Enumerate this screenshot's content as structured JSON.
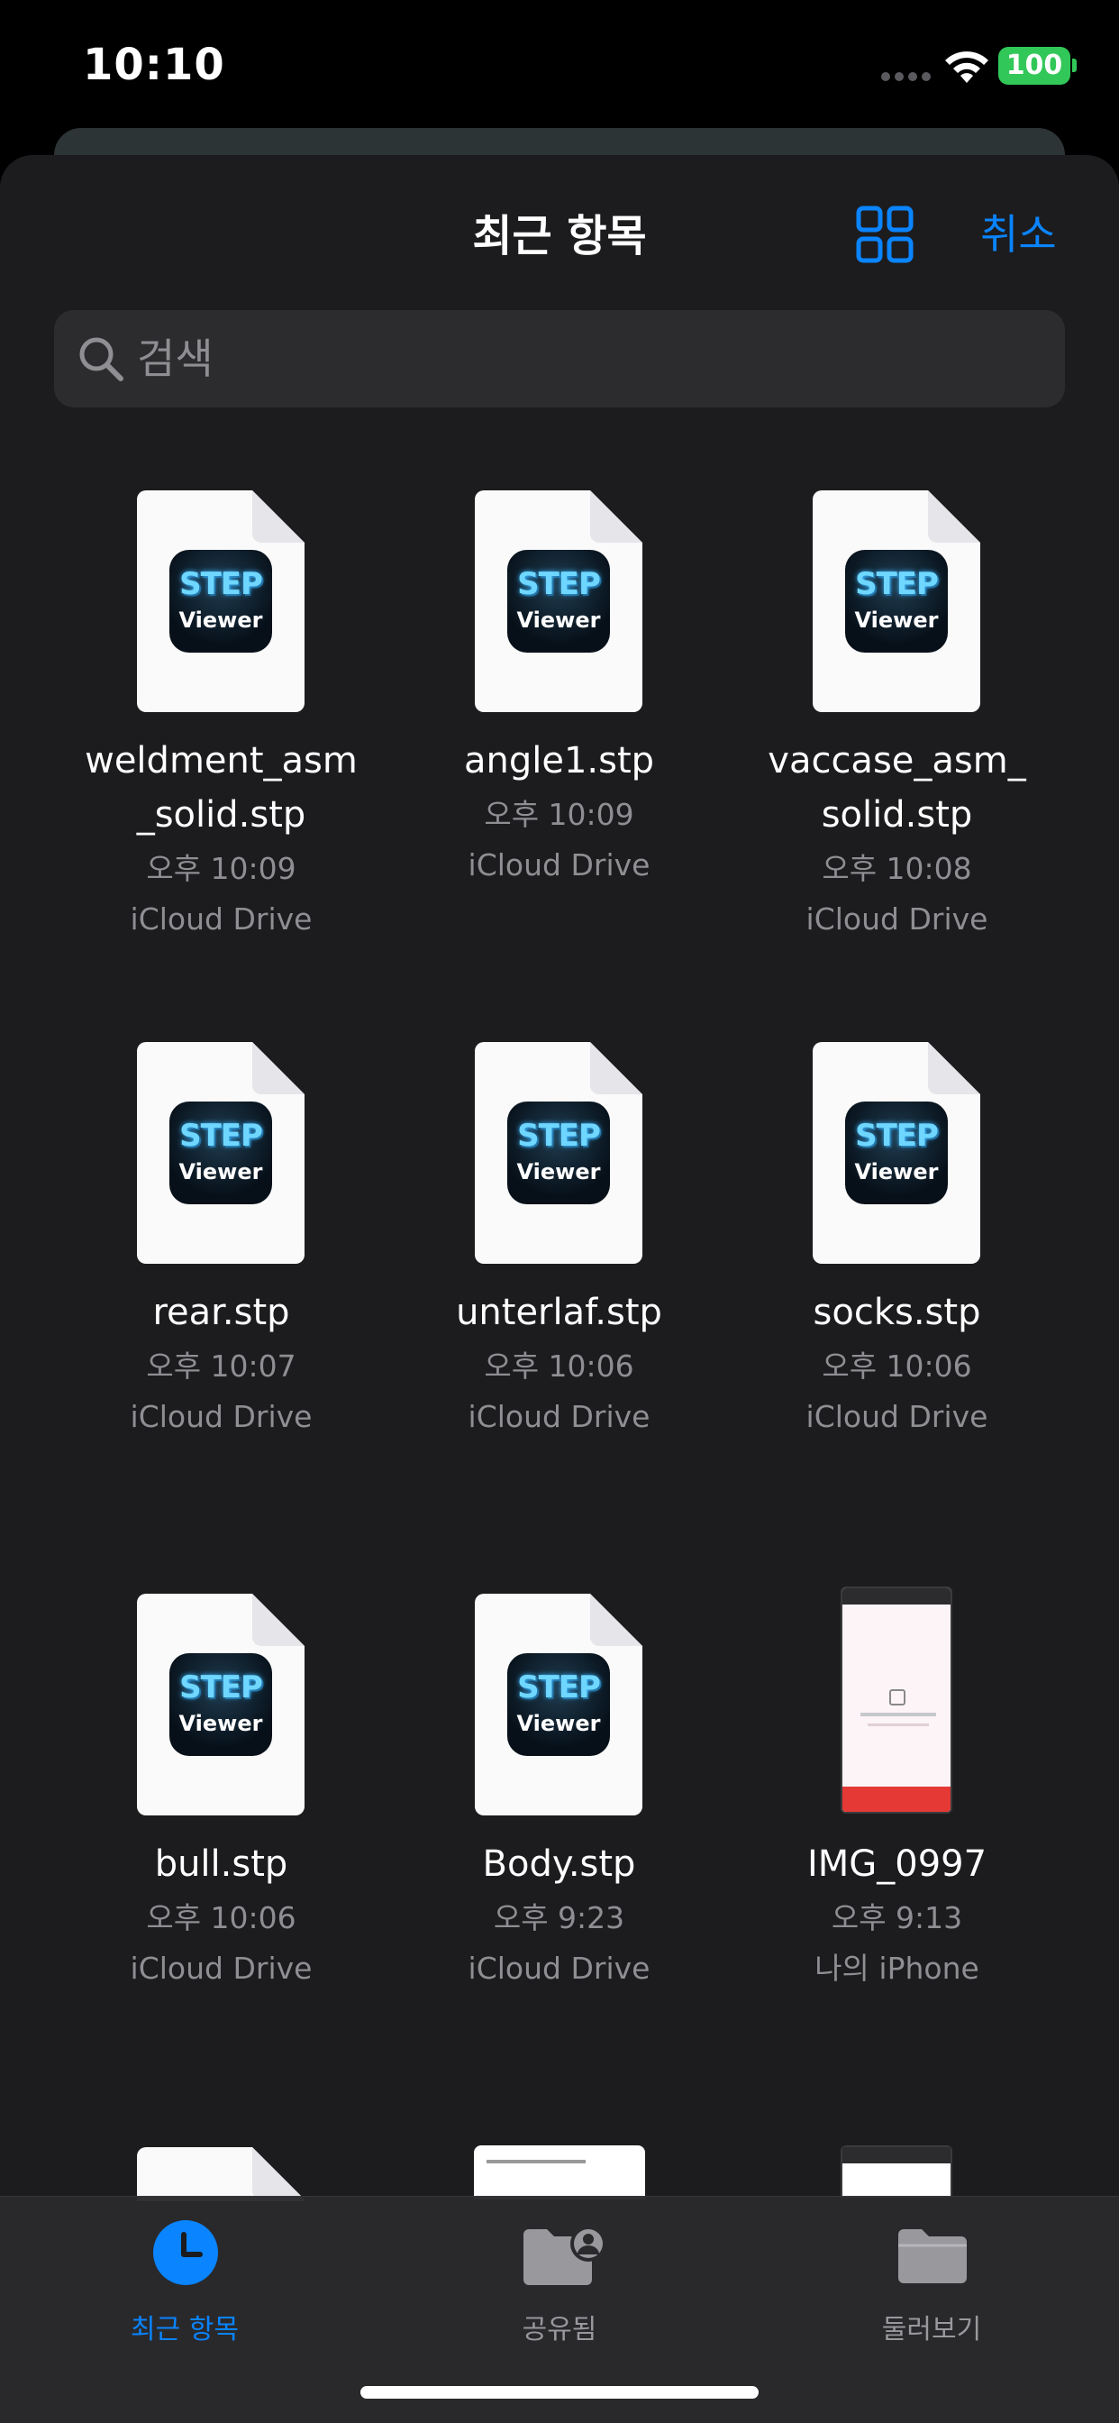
{
  "status_bar": {
    "time": "10:10",
    "battery": "100"
  },
  "nav": {
    "title": "최근 항목",
    "cancel_label": "취소",
    "view_toggle_icon": "grid-icon"
  },
  "search": {
    "placeholder": "검색",
    "icon": "search-icon"
  },
  "files": [
    {
      "name_lines": [
        "weldment_asm",
        "_solid.stp"
      ],
      "time": "오후 10:09",
      "location": "iCloud Drive",
      "thumb": "step-viewer-doc"
    },
    {
      "name_lines": [
        "angle1.stp"
      ],
      "time": "오후 10:09",
      "location": "iCloud Drive",
      "thumb": "step-viewer-doc"
    },
    {
      "name_lines": [
        "vaccase_asm_",
        "solid.stp"
      ],
      "time": "오후 10:08",
      "location": "iCloud Drive",
      "thumb": "step-viewer-doc"
    },
    {
      "name_lines": [
        "rear.stp"
      ],
      "time": "오후 10:07",
      "location": "iCloud Drive",
      "thumb": "step-viewer-doc"
    },
    {
      "name_lines": [
        "unterlaf.stp"
      ],
      "time": "오후 10:06",
      "location": "iCloud Drive",
      "thumb": "step-viewer-doc"
    },
    {
      "name_lines": [
        "socks.stp"
      ],
      "time": "오후 10:06",
      "location": "iCloud Drive",
      "thumb": "step-viewer-doc"
    },
    {
      "name_lines": [
        "bull.stp"
      ],
      "time": "오후 10:06",
      "location": "iCloud Drive",
      "thumb": "step-viewer-doc"
    },
    {
      "name_lines": [
        "Body.stp"
      ],
      "time": "오후 9:23",
      "location": "iCloud Drive",
      "thumb": "step-viewer-doc"
    },
    {
      "name_lines": [
        "IMG_0997"
      ],
      "time": "오후 9:13",
      "location": "나의 iPhone",
      "thumb": "screenshot"
    }
  ],
  "app_icon": {
    "line1": "STEP",
    "line2": "Viewer"
  },
  "tab_bar": {
    "tabs": [
      {
        "label": "최근 항목",
        "icon": "clock-icon",
        "active": true
      },
      {
        "label": "공유됨",
        "icon": "shared-folder-icon",
        "active": false
      },
      {
        "label": "둘러보기",
        "icon": "folder-icon",
        "active": false
      }
    ]
  },
  "colors": {
    "accent": "#0a84ff",
    "sheet_bg": "#1c1c1e",
    "search_bg": "#2c2c2e",
    "secondary_text": "#8e8e93",
    "battery": "#32c759"
  }
}
